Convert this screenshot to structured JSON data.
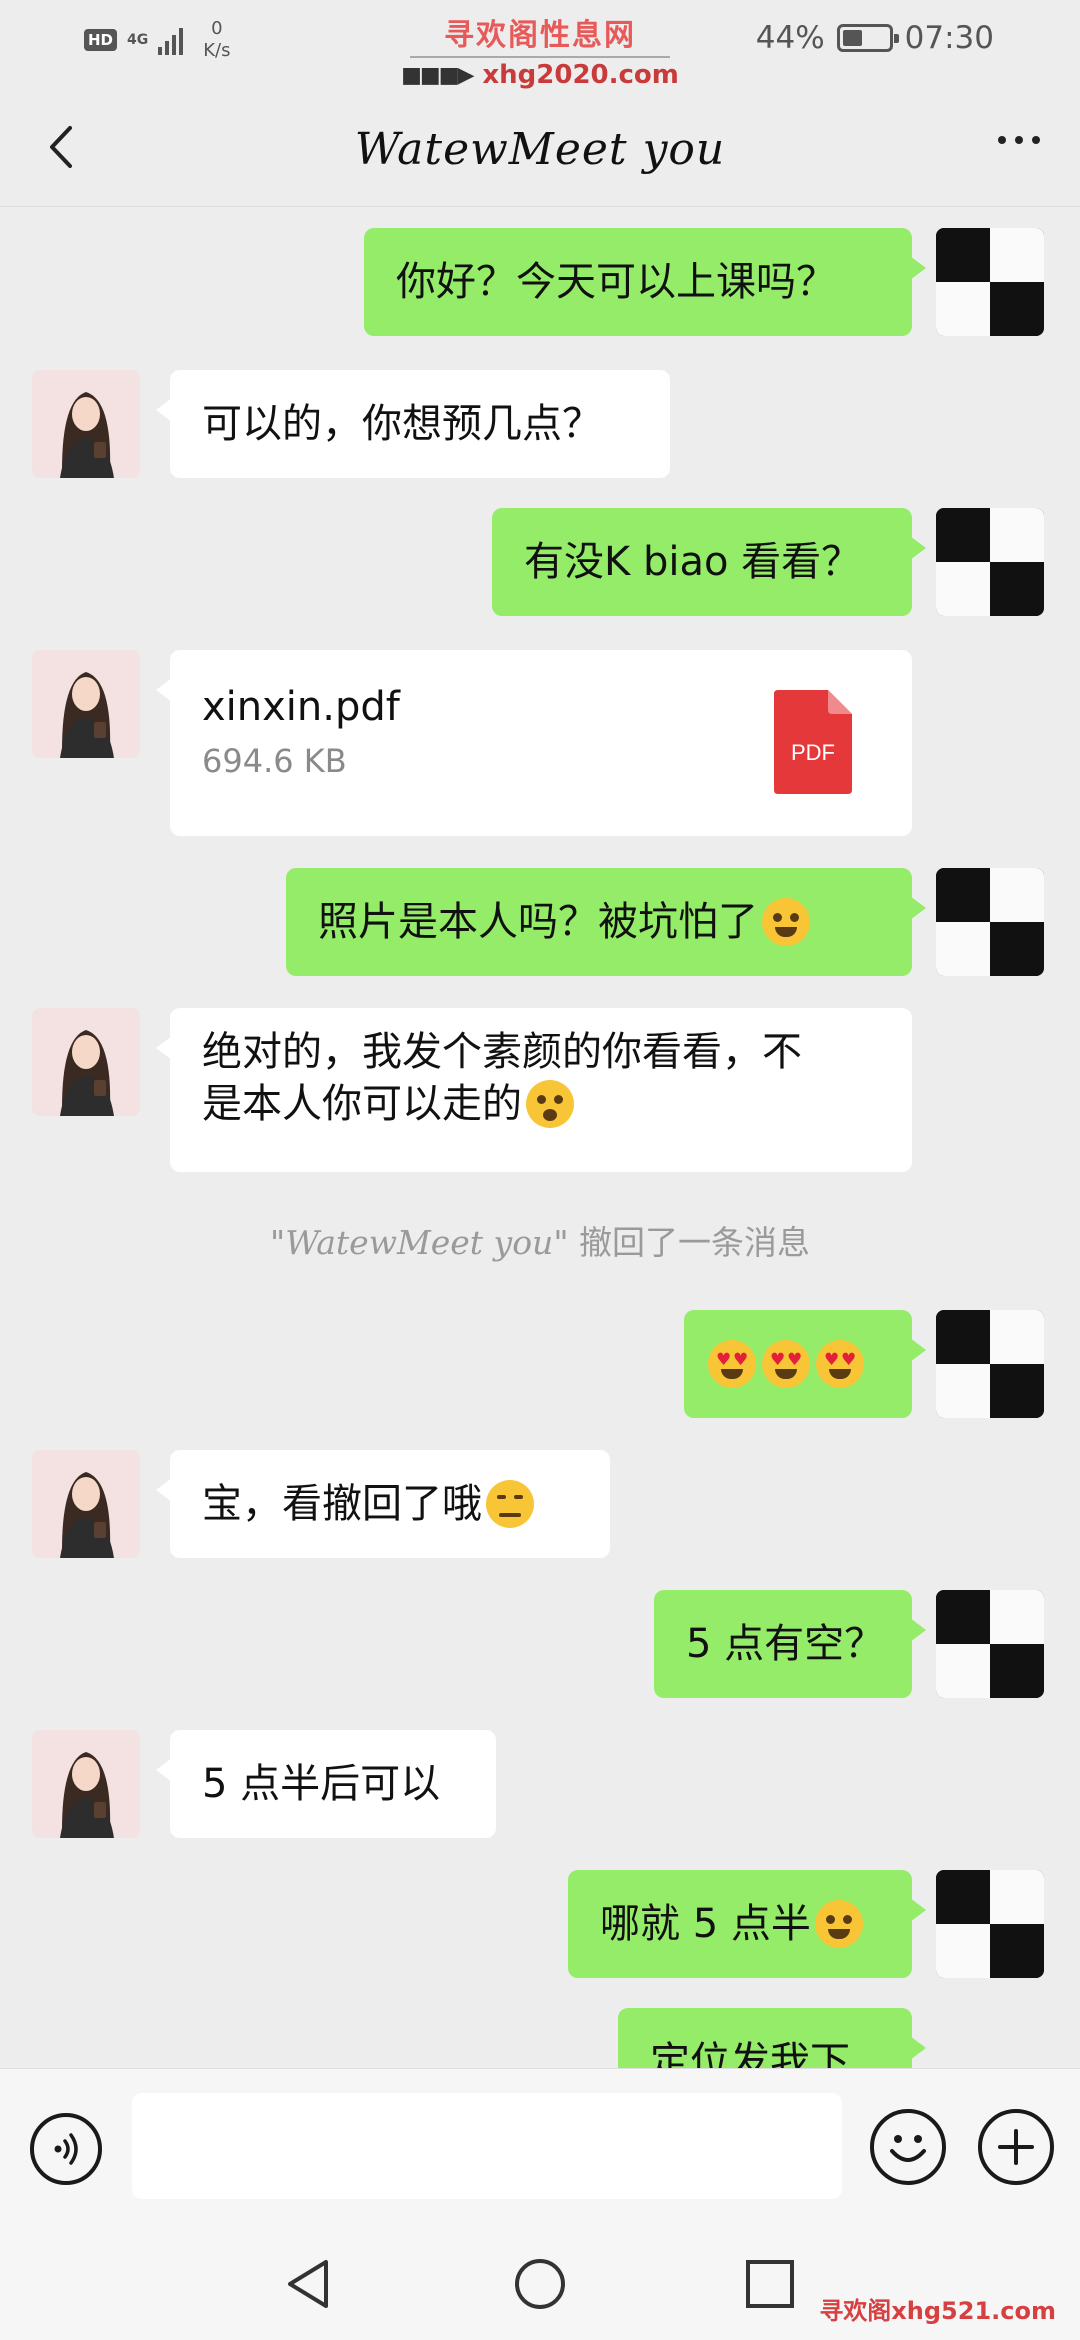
{
  "status_bar": {
    "hd": "HD",
    "network": "4G",
    "speed_value": "0",
    "speed_unit": "K/s",
    "battery_percent": "44%",
    "battery_level": 0.44,
    "time": "07:30"
  },
  "watermark": {
    "top_title": "寻欢阁性息网",
    "top_arrow": "■■■▶",
    "top_url": "xhg2020.com",
    "bottom": "寻欢阁xhg521.com"
  },
  "header": {
    "title": "WatewMeet you",
    "back_icon": "chevron-left-icon",
    "more_icon": "more-horizontal-icon"
  },
  "messages": [
    {
      "side": "right",
      "text": "你好？今天可以上课吗？"
    },
    {
      "side": "left",
      "text": "可以的，你想预几点？"
    },
    {
      "side": "right",
      "text": "有没K biao 看看？"
    },
    {
      "side": "left",
      "type": "file",
      "file_name": "xinxin.pdf",
      "file_size": "694.6 KB",
      "icon_label": "PDF"
    },
    {
      "side": "right",
      "text": "照片是本人吗？被坑怕了",
      "emoji": "laughing-tears-emoji"
    },
    {
      "side": "left",
      "text_line1": "绝对的，我发个素颜的你看看，不",
      "text_line2": "是本人你可以走的",
      "emoji": "shushing-emoji"
    },
    {
      "side": "right",
      "emojis": [
        "heart-eyes-emoji",
        "heart-eyes-emoji",
        "heart-eyes-emoji"
      ]
    },
    {
      "side": "left",
      "text": "宝，看撤回了哦",
      "emoji": "smirk-emoji"
    },
    {
      "side": "right",
      "text": "5 点有空？"
    },
    {
      "side": "left",
      "text": "5 点半后可以"
    },
    {
      "side": "right",
      "text": "哪就 5 点半",
      "emoji": "hugging-emoji"
    },
    {
      "side": "right",
      "text": "定位发我下"
    }
  ],
  "system_notice": {
    "quote_open": "\"",
    "name": "WatewMeet you",
    "quote_close": "\"",
    "text": " 撤回了一条消息"
  },
  "input_bar": {
    "voice_icon": "voice-icon",
    "input_value": "",
    "emoji_icon": "smiley-icon",
    "plus_icon": "plus-circle-icon"
  },
  "nav": {
    "back": "triangle-back-icon",
    "home": "circle-home-icon",
    "recents": "square-recents-icon"
  },
  "colors": {
    "background": "#ededed",
    "right_bubble": "#95ec69",
    "left_bubble": "#ffffff",
    "pdf_red": "#e5383b"
  }
}
